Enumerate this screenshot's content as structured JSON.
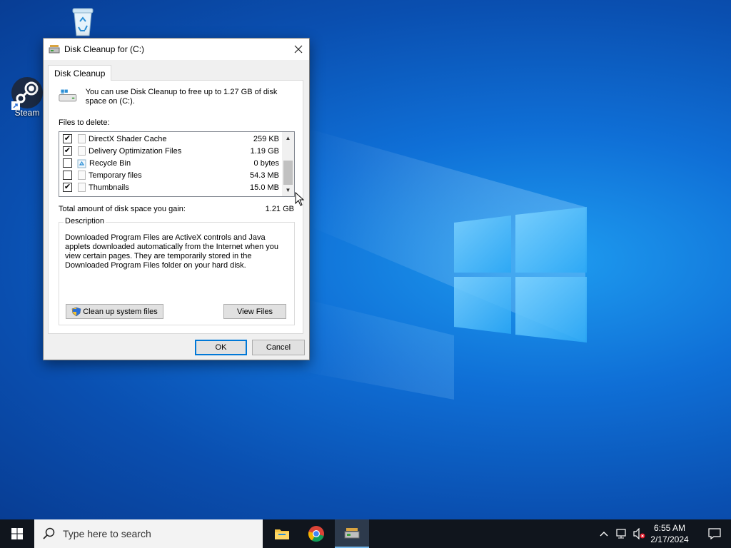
{
  "desktop": {
    "icons": [
      {
        "label": "",
        "icon": "recycle-bin-icon"
      },
      {
        "label": "Steam",
        "icon": "steam-icon"
      }
    ]
  },
  "dialog": {
    "title": "Disk Cleanup for  (C:)",
    "tab": "Disk Cleanup",
    "intro": "You can use Disk Cleanup to free up to 1.27 GB of disk space on  (C:).",
    "files_label": "Files to delete:",
    "files": [
      {
        "name": "DirectX Shader Cache",
        "size": "259 KB",
        "checked": "✔"
      },
      {
        "name": "Delivery Optimization Files",
        "size": "1.19 GB",
        "checked": "✔"
      },
      {
        "name": "Recycle Bin",
        "size": "0 bytes",
        "checked": ""
      },
      {
        "name": "Temporary files",
        "size": "54.3 MB",
        "checked": ""
      },
      {
        "name": "Thumbnails",
        "size": "15.0 MB",
        "checked": "✔"
      }
    ],
    "total_label": "Total amount of disk space you gain:",
    "total_value": "1.21 GB",
    "description_legend": "Description",
    "description": "Downloaded Program Files are ActiveX controls and Java applets downloaded automatically from the Internet when you view certain pages. They are temporarily stored in the Downloaded Program Files folder on your hard disk.",
    "cleanup_system_label": "Clean up system files",
    "view_files_label": "View Files",
    "ok_label": "OK",
    "cancel_label": "Cancel"
  },
  "taskbar": {
    "search_placeholder": "Type here to search",
    "time": "6:55 AM",
    "date": "2/17/2024"
  }
}
